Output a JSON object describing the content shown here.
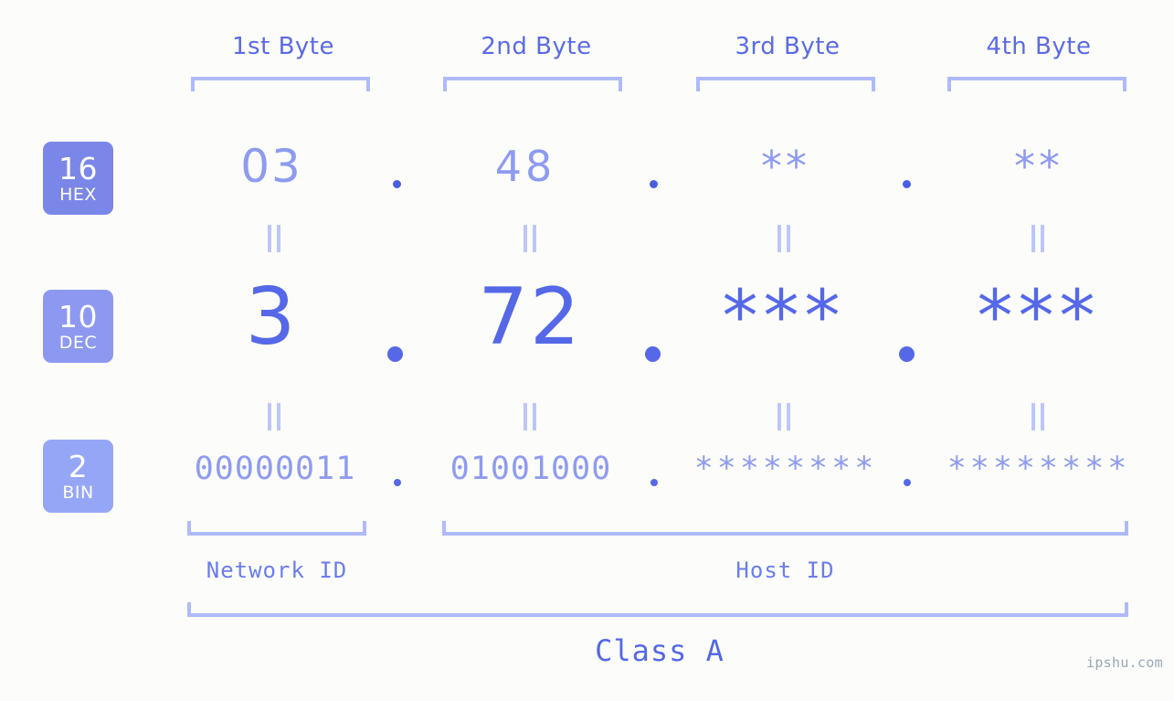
{
  "background_color": "#fcfdfa",
  "accent_color": "#5568e8",
  "light_accent_color": "#aebafc",
  "byte_headers": [
    {
      "label": "1st Byte"
    },
    {
      "label": "2nd Byte"
    },
    {
      "label": "3rd Byte"
    },
    {
      "label": "4th Byte"
    }
  ],
  "bases": [
    {
      "number": "16",
      "name": "HEX",
      "color": "#7b87e8"
    },
    {
      "number": "10",
      "name": "DEC",
      "color": "#8d99f0"
    },
    {
      "number": "2",
      "name": "BIN",
      "color": "#96a6f7"
    }
  ],
  "rows": {
    "hex": {
      "values": [
        "03",
        "48",
        "**",
        "**"
      ]
    },
    "dec": {
      "values": [
        "3",
        "72",
        "***",
        "***"
      ]
    },
    "bin": {
      "values": [
        "00000011",
        "01001000",
        "********",
        "********"
      ]
    }
  },
  "separators": {
    "dot": ".",
    "equals": "="
  },
  "segments": {
    "network_id": "Network ID",
    "host_id": "Host ID"
  },
  "class_label": "Class A",
  "watermark": "ipshu.com"
}
